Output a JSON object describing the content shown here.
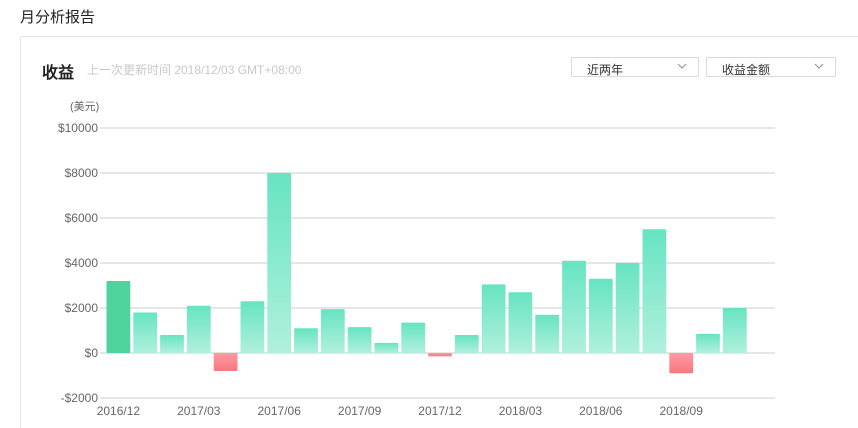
{
  "page": {
    "title": "月分析报告"
  },
  "card": {
    "title": "收益",
    "subtitle": "上一次更新时间 2018/12/03 GMT+08:00"
  },
  "filters": {
    "range": {
      "value": "近两年"
    },
    "metric": {
      "value": "收益金额"
    }
  },
  "colors": {
    "positive_top": "#66e4c1",
    "positive_bottom": "#b0f0dd",
    "highlight": "#4dd39b",
    "negative_top": "#ff9aa2",
    "negative_bottom": "#f7777f",
    "grid": "#cccccc"
  },
  "chart_data": {
    "type": "bar",
    "unit_label": "(美元)",
    "ylim": [
      -2000,
      10000
    ],
    "y_ticks": [
      -2000,
      0,
      2000,
      4000,
      6000,
      8000,
      10000
    ],
    "y_tick_labels": [
      "-$2000",
      "$0",
      "$2000",
      "$4000",
      "$6000",
      "$8000",
      "$10000"
    ],
    "grid": true,
    "categories": [
      "2016/12",
      "2017/01",
      "2017/02",
      "2017/03",
      "2017/04",
      "2017/05",
      "2017/06",
      "2017/07",
      "2017/08",
      "2017/09",
      "2017/10",
      "2017/11",
      "2017/12",
      "2018/01",
      "2018/02",
      "2018/03",
      "2018/04",
      "2018/05",
      "2018/06",
      "2018/07",
      "2018/08",
      "2018/09",
      "2018/10",
      "2018/11",
      "2018/12"
    ],
    "x_tick_labels": [
      "2016/12",
      "2017/03",
      "2017/06",
      "2017/09",
      "2017/12",
      "2018/03",
      "2018/06",
      "2018/09"
    ],
    "x_tick_every": 3,
    "highlight_index": 0,
    "values": [
      3200,
      1800,
      800,
      2100,
      -800,
      2300,
      8000,
      1100,
      1950,
      1150,
      450,
      1350,
      -150,
      800,
      3050,
      2700,
      1700,
      4100,
      3300,
      4000,
      5500,
      -900,
      850,
      2000,
      0
    ]
  }
}
